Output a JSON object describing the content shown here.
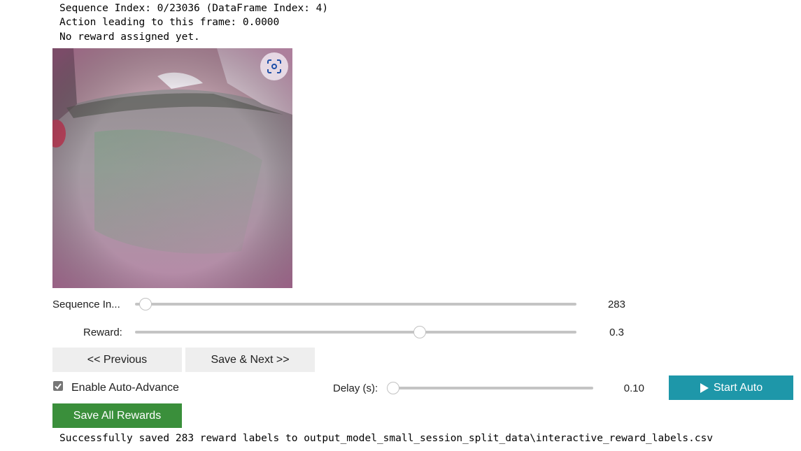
{
  "info": {
    "line1": "Sequence Index: 0/23036 (DataFrame Index: 4)",
    "line2": "Action leading to this frame: 0.0000",
    "line3": "No reward assigned yet."
  },
  "frame": {
    "screenshot_icon": "screenshot-icon"
  },
  "sequence_slider": {
    "label": "Sequence In...",
    "value": "283",
    "fraction": 0.012
  },
  "reward_slider": {
    "label": "Reward:",
    "value": "0.3",
    "fraction": 0.65
  },
  "nav": {
    "previous_label": "<< Previous",
    "save_next_label": "Save & Next >>"
  },
  "auto": {
    "checkbox_label": "Enable Auto-Advance",
    "checked": true,
    "delay_label": "Delay (s):",
    "delay_value": "0.10",
    "delay_fraction": 0.0,
    "start_label": "Start Auto",
    "start_icon": "play-icon"
  },
  "save_all_label": "Save All Rewards",
  "status": "Successfully saved 283 reward labels to output_model_small_session_split_data\\interactive_reward_labels.csv",
  "colors": {
    "teal_button": "#1e97a9",
    "green_button": "#3a8f3b",
    "button_gray": "#eeeeee"
  }
}
